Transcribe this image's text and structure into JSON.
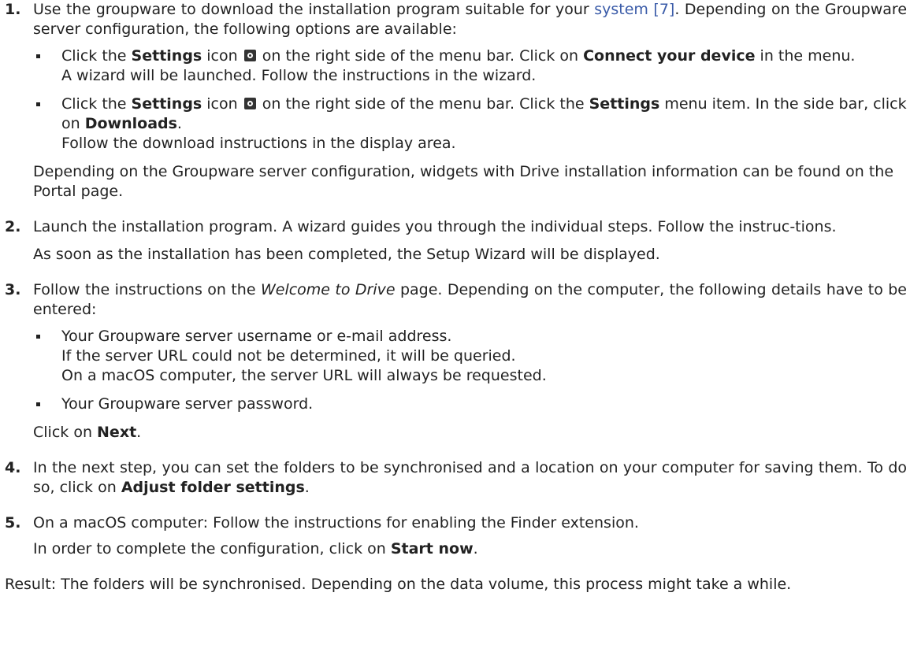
{
  "steps": [
    {
      "num": "1.",
      "t1": "Use the groupware to download the installation program suitable for your ",
      "link": "system [7]",
      "t2": ". Depending on the Groupware server configuration, the following options are available:",
      "bullets": [
        {
          "a": "Click the ",
          "b1": "Settings",
          "c": " icon ",
          "d": " on the right side of the menu bar. Click on ",
          "b2": "Connect your device",
          "e": " in the menu.",
          "line2": "A wizard will be launched. Follow the instructions in the wizard."
        },
        {
          "a": "Click the ",
          "b1": "Settings",
          "c": " icon ",
          "d": " on the right side of the menu bar. Click the ",
          "b2": "Settings",
          "e": " menu item. In the side bar, click on ",
          "b3": "Downloads",
          "f": ".",
          "line2": "Follow the download instructions in the display area."
        }
      ],
      "after": "Depending on the Groupware server configuration, widgets with Drive installation information can be found on the Portal page."
    },
    {
      "num": "2.",
      "t1": "Launch the installation program. A wizard guides you through the individual steps. Follow the instruc-tions.",
      "after": "As soon as the installation has been completed, the Setup Wizard will be displayed."
    },
    {
      "num": "3.",
      "t1": "Follow the instructions on the ",
      "italic": "Welcome to Drive",
      "t2": " page. Depending on the computer, the following details have to be entered:",
      "bullets": [
        {
          "l1": "Your Groupware server username or e-mail address.",
          "l2": "If the server URL could not be determined, it will be queried.",
          "l3": "On a macOS computer, the server URL will always be requested."
        },
        {
          "l1": "Your Groupware server password."
        }
      ],
      "after_a": "Click on ",
      "after_b": "Next",
      "after_c": "."
    },
    {
      "num": "4.",
      "t1": "In the next step, you can set the folders to be synchronised and a location on your computer for saving them. To do so, click on ",
      "b1": "Adjust folder settings",
      "t2": "."
    },
    {
      "num": "5.",
      "t1": "On a macOS computer: Follow the instructions for enabling the Finder extension.",
      "after_a": "In order to complete the configuration, click on ",
      "after_b": "Start now",
      "after_c": "."
    }
  ],
  "result": "Result: The folders will be synchronised. Depending on the data volume, this process might take a while.",
  "icons": {
    "settings": "gear-icon"
  },
  "colors": {
    "text": "#222222",
    "link": "#3a5ba8"
  }
}
